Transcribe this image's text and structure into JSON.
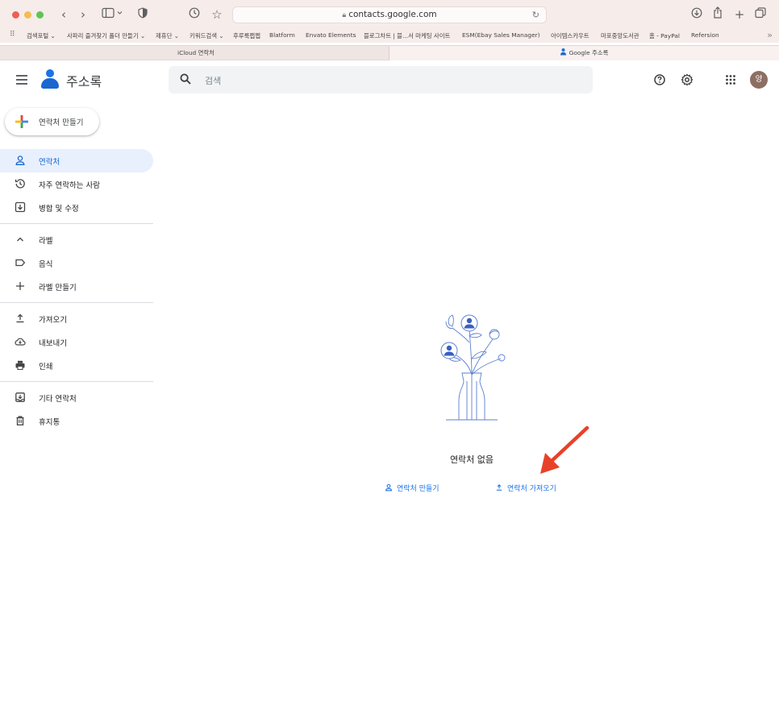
{
  "browser": {
    "url": "contacts.google.com",
    "bookmarks": [
      "검색포털 ⌄",
      "사파리 즐겨찾기 폴더 만들기 ⌄",
      "제휴단 ⌄",
      "키워드검색 ⌄",
      "후루룩쩝쩝",
      "Blatform",
      "Envato Elements",
      "블로그차트 | 블...서 마케팅 사이트",
      "ESM(Ebay Sales Manager)",
      "아이템스카우트",
      "마포중앙도서관",
      "홈 - PayPal",
      "Refersion"
    ],
    "tabs": [
      {
        "label": "iCloud 연락처"
      },
      {
        "label": "Google 주소록"
      }
    ]
  },
  "app": {
    "title": "주소록",
    "search_placeholder": "검색",
    "avatar_initial": "양",
    "create_button": "연락처 만들기",
    "nav": {
      "contacts": "연락처",
      "frequent": "자주 연락하는 사람",
      "merge": "병합 및 수정",
      "labels_header": "라벨",
      "label_food": "음식",
      "create_label": "라벨 만들기",
      "import": "가져오기",
      "export": "내보내기",
      "print": "인쇄",
      "other_contacts": "기타 연락처",
      "trash": "휴지통"
    },
    "empty": {
      "title": "연락처 없음",
      "create_link": "연락처 만들기",
      "import_link": "연락처 가져오기"
    }
  },
  "colors": {
    "accent": "#1a73e8",
    "nav_active_bg": "#e8f0fe",
    "arrow": "#e8412a",
    "avatar": "#8d6e63"
  }
}
